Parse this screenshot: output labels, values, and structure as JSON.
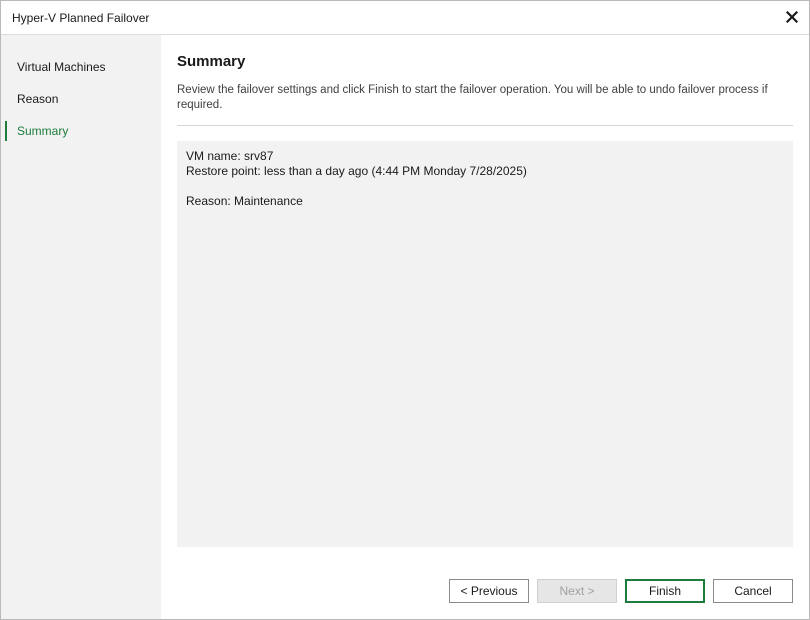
{
  "window": {
    "title": "Hyper-V Planned Failover",
    "close_icon": "close-icon"
  },
  "sidebar": {
    "items": [
      {
        "label": "Virtual Machines",
        "active": false
      },
      {
        "label": "Reason",
        "active": false
      },
      {
        "label": "Summary",
        "active": true
      }
    ]
  },
  "main": {
    "title": "Summary",
    "description": "Review the failover settings and click Finish to start the failover operation. You will be able to undo failover process if required.",
    "summary_lines": [
      "VM name: srv87",
      "Restore point: less than a day ago (4:44 PM Monday 7/28/2025)",
      "",
      "Reason: Maintenance"
    ]
  },
  "buttons": {
    "previous": "< Previous",
    "next": "Next >",
    "finish": "Finish",
    "cancel": "Cancel"
  },
  "colors": {
    "accent": "#1d7c3c",
    "sidebar_bg": "#f2f2f2",
    "summary_bg": "#f2f2f2"
  }
}
